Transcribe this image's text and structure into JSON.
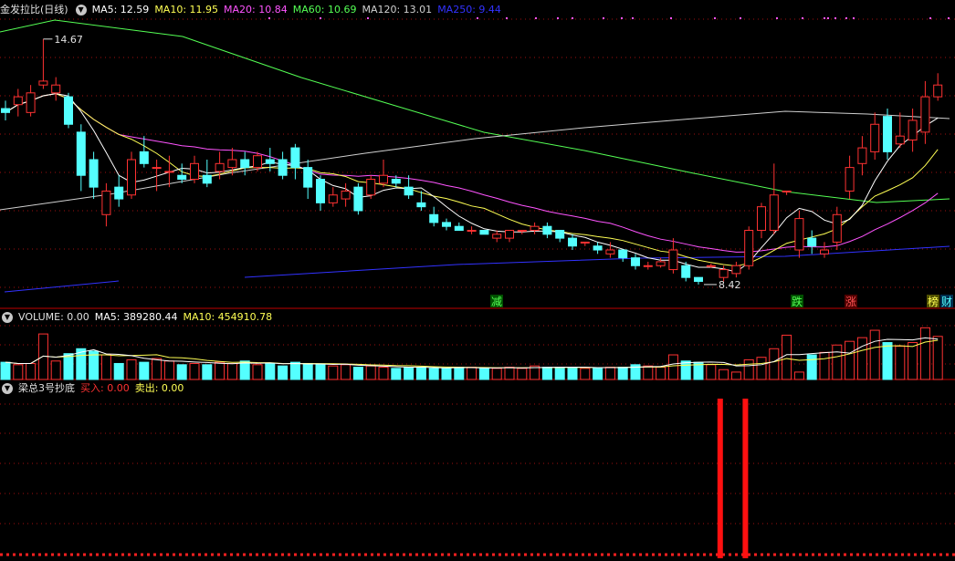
{
  "colors": {
    "up": "#ff3232",
    "down": "#54ffff",
    "ma5": "#ffffff",
    "ma10": "#ffff54",
    "ma20": "#ff54ff",
    "ma60": "#54ff54",
    "ma120": "#d0d0d0",
    "ma250": "#3232ff",
    "grid": "#a01010",
    "signal": "#ff1010"
  },
  "main": {
    "title": "金发拉比(日线)",
    "toggle_icon": "chevron-down-icon",
    "ma": [
      {
        "label": "MA5: 12.59",
        "color": "#ffffff"
      },
      {
        "label": "MA10: 11.95",
        "color": "#ffff54"
      },
      {
        "label": "MA20: 10.84",
        "color": "#ff54ff"
      },
      {
        "label": "MA60: 10.69",
        "color": "#54ff54"
      },
      {
        "label": "MA120: 13.01",
        "color": "#d0d0d0"
      },
      {
        "label": "MA250: 9.44",
        "color": "#3232ff"
      }
    ],
    "high_label": "14.67",
    "low_label": "8.42",
    "events": [
      {
        "text": "减",
        "color": "#54ff54",
        "bg": "#005000"
      },
      {
        "text": "跌",
        "color": "#54ff54",
        "bg": "#005000"
      },
      {
        "text": "涨",
        "color": "#ff5454",
        "bg": "#500000"
      },
      {
        "text": "榜",
        "color": "#ffff54",
        "bg": "#505000"
      },
      {
        "text": "财",
        "color": "#54ffff",
        "bg": "#003050"
      }
    ]
  },
  "volume": {
    "title": "VOLUME: 0.00",
    "ma": [
      {
        "label": "MA5: 389280.44",
        "color": "#ffffff"
      },
      {
        "label": "MA10: 454910.78",
        "color": "#ffff54"
      }
    ]
  },
  "indicator": {
    "title": "梁总3号抄底",
    "buy_label": "买入: 0.00",
    "sell_label": "卖出: 0.00",
    "buy_color": "#ff3232",
    "sell_color": "#ffff54"
  },
  "candles": [
    [
      12.9,
      13.1,
      12.6,
      12.8
    ],
    [
      13.0,
      13.4,
      12.7,
      13.2
    ],
    [
      12.8,
      13.5,
      12.7,
      13.3
    ],
    [
      13.5,
      14.67,
      13.4,
      13.6
    ],
    [
      13.3,
      13.7,
      13.1,
      13.5
    ],
    [
      13.2,
      13.3,
      12.4,
      12.5
    ],
    [
      12.3,
      12.5,
      10.8,
      11.2
    ],
    [
      11.6,
      11.8,
      10.6,
      10.9
    ],
    [
      10.2,
      11.0,
      9.9,
      10.8
    ],
    [
      10.9,
      11.2,
      10.4,
      10.6
    ],
    [
      10.7,
      11.8,
      10.6,
      11.6
    ],
    [
      11.8,
      12.2,
      11.4,
      11.5
    ],
    [
      11.4,
      11.6,
      10.8,
      11.4
    ],
    [
      11.3,
      11.7,
      10.9,
      11.3
    ],
    [
      11.2,
      11.5,
      11.0,
      11.1
    ],
    [
      11.1,
      11.7,
      11.0,
      11.5
    ],
    [
      11.2,
      11.6,
      10.9,
      11.0
    ],
    [
      11.3,
      11.8,
      11.1,
      11.5
    ],
    [
      11.4,
      11.9,
      11.2,
      11.6
    ],
    [
      11.6,
      11.8,
      11.2,
      11.4
    ],
    [
      11.4,
      11.8,
      11.3,
      11.7
    ],
    [
      11.6,
      11.9,
      11.3,
      11.5
    ],
    [
      11.6,
      11.8,
      11.1,
      11.2
    ],
    [
      11.9,
      12.0,
      11.1,
      11.4
    ],
    [
      11.4,
      11.6,
      10.6,
      10.9
    ],
    [
      11.1,
      11.2,
      10.3,
      10.5
    ],
    [
      10.5,
      10.9,
      10.4,
      10.7
    ],
    [
      10.6,
      11.0,
      10.4,
      10.8
    ],
    [
      10.9,
      11.0,
      10.2,
      10.3
    ],
    [
      10.7,
      11.2,
      10.6,
      11.1
    ],
    [
      11.0,
      11.6,
      10.9,
      11.2
    ],
    [
      11.1,
      11.2,
      10.9,
      11.0
    ],
    [
      10.9,
      11.2,
      10.6,
      10.7
    ],
    [
      10.5,
      10.8,
      10.3,
      10.4
    ],
    [
      10.2,
      10.4,
      9.9,
      10.0
    ],
    [
      10.0,
      10.1,
      9.8,
      9.9
    ],
    [
      9.9,
      10.0,
      9.8,
      9.8
    ],
    [
      9.8,
      9.9,
      9.7,
      9.8
    ],
    [
      9.8,
      9.8,
      9.7,
      9.7
    ],
    [
      9.6,
      9.8,
      9.5,
      9.7
    ],
    [
      9.6,
      9.8,
      9.5,
      9.8
    ],
    [
      9.8,
      9.8,
      9.7,
      9.8
    ],
    [
      9.8,
      10.0,
      9.7,
      9.9
    ],
    [
      9.9,
      10.0,
      9.6,
      9.7
    ],
    [
      9.8,
      9.8,
      9.5,
      9.6
    ],
    [
      9.6,
      9.7,
      9.3,
      9.4
    ],
    [
      9.5,
      9.5,
      9.4,
      9.5
    ],
    [
      9.4,
      9.5,
      9.2,
      9.3
    ],
    [
      9.2,
      9.5,
      9.1,
      9.3
    ],
    [
      9.3,
      9.3,
      9.0,
      9.1
    ],
    [
      9.1,
      9.2,
      8.8,
      8.9
    ],
    [
      8.9,
      9.0,
      8.8,
      8.9
    ],
    [
      8.9,
      9.1,
      8.85,
      9.0
    ],
    [
      8.8,
      9.6,
      8.7,
      9.3
    ],
    [
      8.9,
      9.0,
      8.5,
      8.6
    ],
    [
      8.6,
      8.6,
      8.42,
      8.5
    ],
    [
      8.9,
      8.95,
      8.85,
      8.9
    ],
    [
      8.6,
      8.9,
      8.5,
      8.8
    ],
    [
      8.7,
      9.0,
      8.6,
      8.9
    ],
    [
      8.9,
      9.9,
      8.8,
      9.8
    ],
    [
      9.8,
      10.5,
      9.6,
      10.4
    ],
    [
      9.8,
      11.5,
      9.7,
      10.7
    ],
    [
      10.8,
      10.8,
      10.7,
      10.8
    ],
    [
      9.3,
      10.3,
      9.1,
      10.1
    ],
    [
      9.6,
      9.8,
      9.2,
      9.4
    ],
    [
      9.2,
      9.5,
      9.1,
      9.3
    ],
    [
      9.5,
      10.4,
      9.3,
      10.2
    ],
    [
      10.8,
      11.7,
      10.6,
      11.4
    ],
    [
      11.5,
      12.2,
      11.2,
      11.9
    ],
    [
      11.8,
      12.8,
      11.6,
      12.5
    ],
    [
      12.7,
      12.9,
      11.6,
      11.8
    ],
    [
      12.0,
      12.8,
      11.9,
      12.2
    ],
    [
      12.1,
      12.9,
      11.8,
      12.6
    ],
    [
      12.3,
      13.6,
      12.0,
      13.2
    ],
    [
      13.2,
      13.8,
      13.1,
      13.5
    ]
  ],
  "volumes": [
    1.4,
    1.2,
    1.3,
    3.7,
    1.5,
    2.1,
    2.5,
    2.3,
    2.0,
    1.3,
    1.6,
    1.4,
    1.7,
    1.5,
    1.2,
    1.3,
    1.2,
    1.4,
    1.3,
    1.5,
    1.2,
    1.3,
    1.1,
    1.4,
    1.3,
    1.2,
    1.1,
    1.2,
    1.0,
    1.1,
    1.0,
    0.9,
    1.0,
    1.0,
    0.9,
    0.9,
    1.0,
    1.0,
    0.9,
    0.9,
    1.0,
    0.9,
    1.1,
    1.0,
    1.0,
    1.0,
    0.9,
    0.9,
    1.0,
    1.0,
    1.2,
    1.1,
    1.0,
    2.0,
    1.5,
    1.4,
    1.2,
    0.8,
    0.6,
    1.6,
    1.8,
    2.5,
    3.6,
    0.6,
    2.0,
    2.2,
    2.8,
    3.1,
    3.4,
    4.0,
    3.0,
    2.7,
    3.0,
    4.2,
    3.5
  ],
  "signals": [
    {
      "index": 56,
      "height": 1.0
    },
    {
      "index": 58,
      "height": 1.0
    }
  ]
}
